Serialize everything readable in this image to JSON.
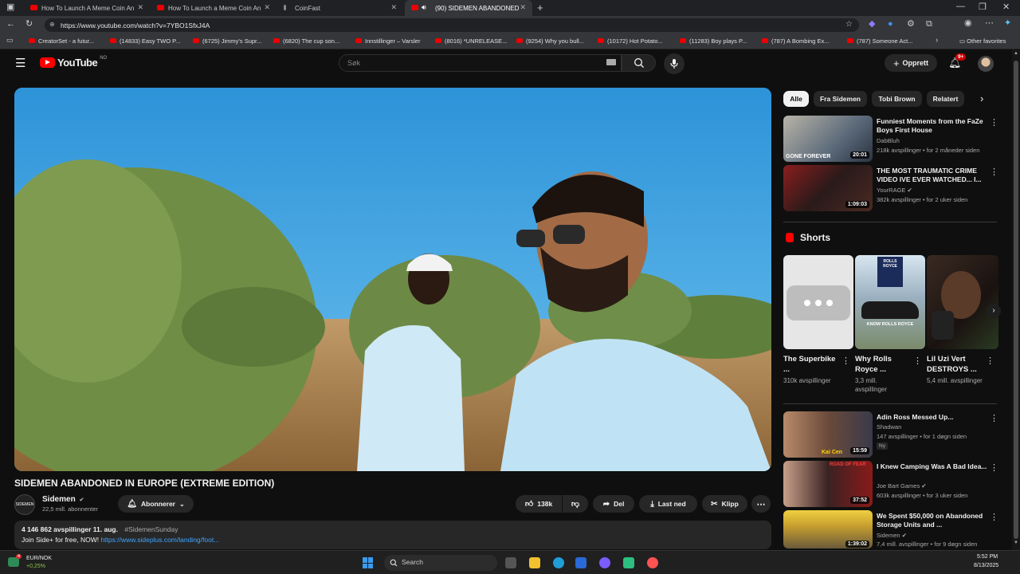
{
  "browser": {
    "tabs": [
      {
        "label": "How To Launch A Meme Coin An"
      },
      {
        "label": "How To Launch a Meme Coin An"
      },
      {
        "label": "CoinFast"
      },
      {
        "label": "(90) SIDEMEN ABANDONED"
      }
    ],
    "url": "https://www.youtube.com/watch?v=7YBO1SfxJ4A",
    "bookmarks": [
      "CreatorSet - a futur...",
      "(14833) Easy TWO P...",
      "(6725) Jimmy's Supr...",
      "(6820) The cup son...",
      "Innstillinger – Varsler",
      "(8016) *UNRELEASE...",
      "(9254) Why you bull...",
      "(10172) Hot Potato...",
      "(11283) Boy plays P...",
      "(787) A Bombing Ex...",
      "(787) Someone Act..."
    ],
    "other_favorites": "Other favorites"
  },
  "youtube": {
    "logo_text": "YouTube",
    "region": "NO",
    "search_placeholder": "Søk",
    "create_label": "Opprett",
    "notification_count": "9+"
  },
  "video": {
    "title": "SIDEMEN ABANDONED IN EUROPE (EXTREME EDITION)",
    "channel": "Sidemen",
    "channel_avatar_text": "SIDEMEN",
    "subscribers": "22,5 mill. abonnenter",
    "subscribe_label": "Abonnerer",
    "likes": "138k",
    "share_label": "Del",
    "download_label": "Last ned",
    "clip_label": "Klipp",
    "views_date": "4 146 862 avspillinger  11. aug.",
    "hashtag": "#SidemenSunday",
    "desc_text": "Join Side+ for free, NOW! ",
    "desc_link": "https://www.sideplus.com/landing/foot..."
  },
  "sidebar": {
    "chips": [
      "Alle",
      "Fra Sidemen",
      "Tobi Brown",
      "Relatert"
    ],
    "recommendations_top": [
      {
        "title": "Funniest Moments from the FaZe Boys First House",
        "channel": "DabBluh",
        "meta": "218k avspillinger • for 2 måneder siden",
        "duration": "20:01",
        "thumb_text": "GONE FOREVER"
      },
      {
        "title": "THE MOST TRAUMATIC CRIME VIDEO IVE EVER WATCHED... I...",
        "channel": "YourRAGE",
        "meta": "382k avspillinger • for 2 uker siden",
        "duration": "1:09:03"
      }
    ],
    "shorts_label": "Shorts",
    "shorts": [
      {
        "title": "The Superbike ...",
        "views": "310k avspillinger"
      },
      {
        "title": "Why Rolls Royce ...",
        "views": "3,3 mill. avspillinger",
        "thumb_text": "ROLLS ROYCE",
        "caption": "KNOW ROLLS ROYCE"
      },
      {
        "title": "Lil Uzi Vert DESTROYS ...",
        "views": "5,4 mill. avspillinger"
      }
    ],
    "recommendations_bottom": [
      {
        "title": "Adin Ross Messed Up...",
        "channel": "Shadwan",
        "meta": "147 avspillinger • for 1 døgn siden",
        "badge": "Ny",
        "duration": "15:59",
        "thumb_text": "Kai Cen"
      },
      {
        "title": "I Knew Camping Was A Bad Idea...",
        "channel": "Joe Bart Games",
        "meta": "603k avspillinger • for 3 uker siden",
        "duration": "37:52",
        "thumb_text": "ROAD OF FEAR"
      },
      {
        "title": "We Spent $50,000 on Abandoned Storage Units and ...",
        "channel": "Sidemen",
        "meta": "7,4 mill. avspillinger • for 9 døgn siden",
        "duration": "1:39:02"
      }
    ]
  },
  "taskbar": {
    "ticker_label": "EUR/NOK",
    "ticker_change": "+0,25%",
    "ticker_badge": "4",
    "search_label": "Search",
    "time": "5:52 PM",
    "date": "8/13/2025"
  }
}
